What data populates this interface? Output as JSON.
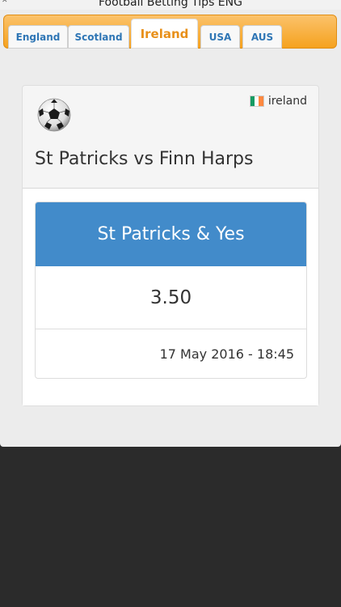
{
  "app": {
    "title": "Football Betting Tips ENG"
  },
  "tabs": [
    {
      "label": "England"
    },
    {
      "label": "Scotland"
    },
    {
      "label": "Ireland"
    },
    {
      "label": "USA"
    },
    {
      "label": "AUS"
    }
  ],
  "active_tab": "Ireland",
  "card": {
    "country": "ireland",
    "match": "St Patricks vs Finn Harps",
    "tip": "St Patricks & Yes",
    "odds": "3.50",
    "kickoff": "17 May 2016 - 18:45"
  },
  "colors": {
    "accent_orange": "#f5a21f",
    "tip_header_blue": "#428bca",
    "tab_text_blue": "#2f76b5",
    "active_tab_text": "#e8901a"
  },
  "icons": {
    "ball": "soccer-ball-icon",
    "flag": "ireland-flag-icon"
  }
}
